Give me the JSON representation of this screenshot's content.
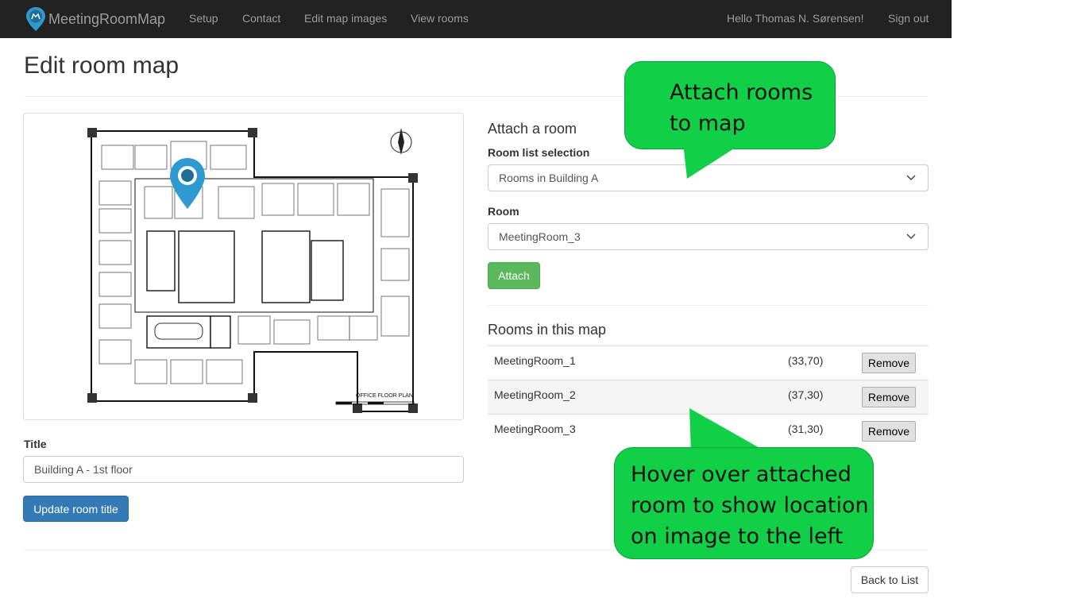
{
  "navbar": {
    "brand": "MeetingRoomMap",
    "brand_icon": "map-pin-logo-icon",
    "links": [
      "Setup",
      "Contact",
      "Edit map images",
      "View rooms"
    ],
    "greeting": "Hello Thomas N. Sørensen!",
    "sign_out": "Sign out"
  },
  "page": {
    "title": "Edit room map"
  },
  "map": {
    "caption": "OFFICE FLOOR PLAN",
    "marker_icon": "location-pin-icon"
  },
  "title_form": {
    "label": "Title",
    "value": "Building A - 1st floor",
    "button": "Update room title"
  },
  "attach": {
    "heading": "Attach a room",
    "room_list_label": "Room list selection",
    "room_list_value": "Rooms in Building A",
    "room_label": "Room",
    "room_value": "MeetingRoom_3",
    "button": "Attach"
  },
  "rooms": {
    "heading": "Rooms in this map",
    "items": [
      {
        "name": "MeetingRoom_1",
        "coords": "(33,70)",
        "action": "Remove"
      },
      {
        "name": "MeetingRoom_2",
        "coords": "(37,30)",
        "action": "Remove"
      },
      {
        "name": "MeetingRoom_3",
        "coords": "(31,30)",
        "action": "Remove"
      }
    ]
  },
  "back_link": "Back to List",
  "callouts": {
    "attach": [
      "Attach rooms",
      "to map"
    ],
    "hover": [
      "Hover over attached",
      "room to show location",
      "on image to the left"
    ],
    "color": "#12cf48"
  },
  "colors": {
    "navbar": "#222222",
    "primary": "#337ab7",
    "success": "#5cb85c",
    "marker": "#2e9ad0"
  }
}
